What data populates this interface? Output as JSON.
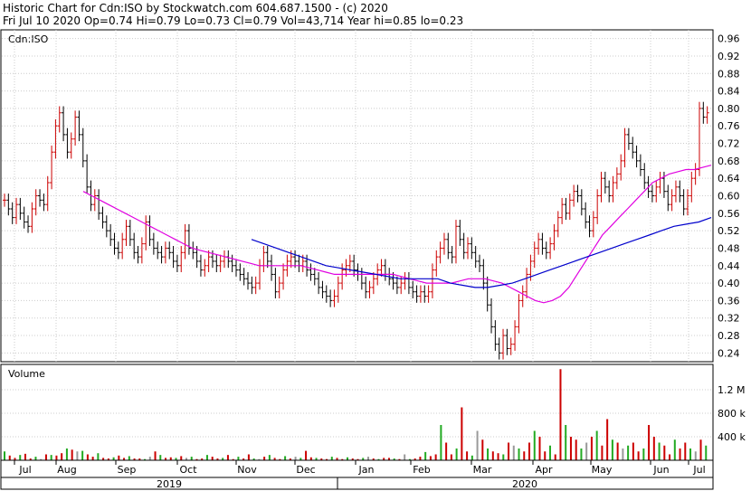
{
  "header": {
    "title": "Historic Chart for Cdn:ISO by Stockwatch.com 604.687.1500 - (c) 2020",
    "quote": "Fri Jul 10 2020   Op=0.74   Hi=0.79   Lo=0.73   Cl=0.79   Vol=43,714   Year hi=0.85   lo=0.23"
  },
  "colors": {
    "up": "#cc0000",
    "down": "#000000",
    "ma_short": "#e000e0",
    "ma_long": "#0000cc",
    "vol_up": "#cc0000",
    "vol_down": "#22aa22",
    "vol_neutral": "#999999",
    "grid": "#cccccc",
    "frame": "#000000"
  },
  "chart_data": [
    {
      "type": "candlestick",
      "label": "Cdn:ISO",
      "ylim": [
        0.22,
        0.98
      ],
      "yticks": [
        "0.96",
        "0.92",
        "0.88",
        "0.84",
        "0.80",
        "0.76",
        "0.72",
        "0.68",
        "0.64",
        "0.60",
        "0.56",
        "0.52",
        "0.48",
        "0.44",
        "0.40",
        "0.36",
        "0.32",
        "0.28",
        "0.24"
      ],
      "months": [
        "Jul",
        "Aug",
        "Sep",
        "Oct",
        "Nov",
        "Dec",
        "Jan",
        "Feb",
        "Mar",
        "Apr",
        "May",
        "Jun",
        "Jul"
      ],
      "years": [
        "2019",
        "2020"
      ],
      "series": [
        {
          "name": "price_close",
          "values": [
            0.59,
            0.57,
            0.55,
            0.58,
            0.56,
            0.54,
            0.53,
            0.57,
            0.6,
            0.59,
            0.58,
            0.63,
            0.7,
            0.76,
            0.79,
            0.74,
            0.7,
            0.73,
            0.78,
            0.74,
            0.68,
            0.62,
            0.58,
            0.6,
            0.56,
            0.54,
            0.52,
            0.5,
            0.48,
            0.47,
            0.5,
            0.53,
            0.5,
            0.47,
            0.46,
            0.49,
            0.54,
            0.5,
            0.48,
            0.47,
            0.46,
            0.48,
            0.47,
            0.45,
            0.44,
            0.47,
            0.52,
            0.48,
            0.47,
            0.45,
            0.43,
            0.44,
            0.46,
            0.45,
            0.44,
            0.45,
            0.46,
            0.45,
            0.44,
            0.43,
            0.42,
            0.41,
            0.4,
            0.39,
            0.4,
            0.44,
            0.47,
            0.45,
            0.42,
            0.38,
            0.4,
            0.43,
            0.45,
            0.46,
            0.45,
            0.44,
            0.45,
            0.43,
            0.42,
            0.41,
            0.39,
            0.38,
            0.37,
            0.36,
            0.37,
            0.4,
            0.43,
            0.44,
            0.45,
            0.43,
            0.42,
            0.4,
            0.38,
            0.39,
            0.41,
            0.43,
            0.44,
            0.42,
            0.41,
            0.4,
            0.39,
            0.4,
            0.41,
            0.39,
            0.38,
            0.37,
            0.38,
            0.37,
            0.38,
            0.43,
            0.46,
            0.48,
            0.5,
            0.47,
            0.46,
            0.53,
            0.5,
            0.47,
            0.49,
            0.47,
            0.45,
            0.44,
            0.4,
            0.35,
            0.3,
            0.26,
            0.24,
            0.28,
            0.25,
            0.26,
            0.3,
            0.36,
            0.38,
            0.42,
            0.45,
            0.48,
            0.5,
            0.48,
            0.47,
            0.49,
            0.52,
            0.55,
            0.58,
            0.56,
            0.59,
            0.61,
            0.6,
            0.57,
            0.54,
            0.52,
            0.55,
            0.6,
            0.64,
            0.62,
            0.6,
            0.63,
            0.65,
            0.68,
            0.74,
            0.72,
            0.7,
            0.68,
            0.66,
            0.63,
            0.61,
            0.6,
            0.62,
            0.64,
            0.61,
            0.58,
            0.6,
            0.62,
            0.6,
            0.57,
            0.6,
            0.64,
            0.66,
            0.8,
            0.78,
            0.79
          ]
        },
        {
          "name": "ma_short",
          "values": [
            0.61,
            0.6,
            0.59,
            0.58,
            0.57,
            0.56,
            0.55,
            0.54,
            0.53,
            0.52,
            0.51,
            0.5,
            0.49,
            0.48,
            0.475,
            0.47,
            0.465,
            0.46,
            0.455,
            0.45,
            0.445,
            0.44,
            0.44,
            0.44,
            0.44,
            0.44,
            0.44,
            0.435,
            0.43,
            0.425,
            0.42,
            0.42,
            0.42,
            0.42,
            0.42,
            0.42,
            0.42,
            0.42,
            0.415,
            0.41,
            0.405,
            0.4,
            0.4,
            0.4,
            0.4,
            0.405,
            0.41,
            0.41,
            0.41,
            0.405,
            0.4,
            0.39,
            0.38,
            0.37,
            0.36,
            0.355,
            0.36,
            0.37,
            0.39,
            0.42,
            0.45,
            0.48,
            0.51,
            0.53,
            0.55,
            0.57,
            0.59,
            0.61,
            0.63,
            0.64,
            0.65,
            0.655,
            0.66,
            0.66,
            0.665,
            0.67
          ]
        },
        {
          "name": "ma_long",
          "values": [
            0.5,
            0.49,
            0.48,
            0.47,
            0.46,
            0.45,
            0.44,
            0.435,
            0.43,
            0.425,
            0.42,
            0.415,
            0.41,
            0.41,
            0.41,
            0.41,
            0.4,
            0.395,
            0.39,
            0.39,
            0.395,
            0.4,
            0.41,
            0.42,
            0.43,
            0.44,
            0.45,
            0.46,
            0.47,
            0.48,
            0.49,
            0.5,
            0.51,
            0.52,
            0.53,
            0.535,
            0.54,
            0.55
          ]
        }
      ]
    },
    {
      "type": "bar",
      "label": "Volume",
      "yticks": [
        "1.2 M",
        "800 k",
        "400 k"
      ],
      "ylim": [
        0,
        1600000
      ],
      "values": [
        150000,
        80000,
        40000,
        90000,
        110000,
        30000,
        60000,
        20000,
        100000,
        90000,
        80000,
        120000,
        200000,
        180000,
        150000,
        160000,
        100000,
        60000,
        120000,
        40000,
        30000,
        50000,
        80000,
        40000,
        70000,
        30000,
        30000,
        20000,
        60000,
        150000,
        90000,
        40000,
        50000,
        40000,
        70000,
        40000,
        60000,
        20000,
        30000,
        90000,
        60000,
        30000,
        40000,
        90000,
        20000,
        60000,
        30000,
        100000,
        30000,
        20000,
        60000,
        90000,
        40000,
        20000,
        70000,
        30000,
        60000,
        40000,
        160000,
        50000,
        40000,
        30000,
        20000,
        60000,
        40000,
        20000,
        50000,
        30000,
        20000,
        40000,
        60000,
        30000,
        20000,
        40000,
        40000,
        30000,
        20000,
        100000,
        20000,
        30000,
        60000,
        140000,
        70000,
        100000,
        600000,
        300000,
        100000,
        200000,
        900000,
        150000,
        80000,
        500000,
        350000,
        200000,
        150000,
        120000,
        100000,
        300000,
        250000,
        200000,
        150000,
        300000,
        500000,
        400000,
        150000,
        250000,
        100000,
        1550000,
        600000,
        400000,
        350000,
        200000,
        300000,
        400000,
        500000,
        250000,
        700000,
        350000,
        300000,
        200000,
        250000,
        300000,
        150000,
        200000,
        600000,
        400000,
        300000,
        250000,
        100000,
        350000,
        200000,
        300000,
        200000,
        150000,
        350000,
        250000
      ]
    }
  ]
}
